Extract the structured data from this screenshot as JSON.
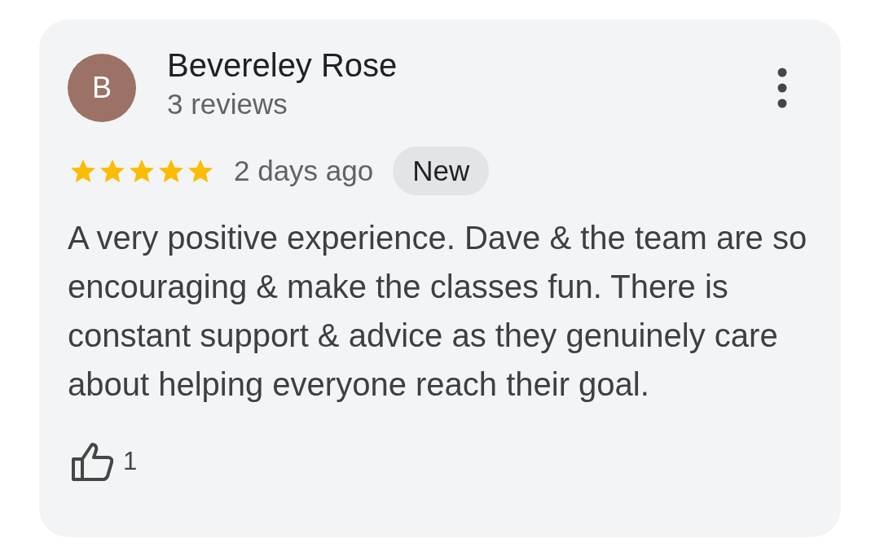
{
  "review": {
    "avatar_letter": "B",
    "author": "Bevereley Rose",
    "review_count": "3 reviews",
    "stars": 5,
    "time": "2 days ago",
    "badge": "New",
    "text": "A very positive experience. Dave & the team are so encouraging & make the classes fun. There is constant support & advice as they genuinely care about helping everyone reach their goal.",
    "likes": "1"
  }
}
